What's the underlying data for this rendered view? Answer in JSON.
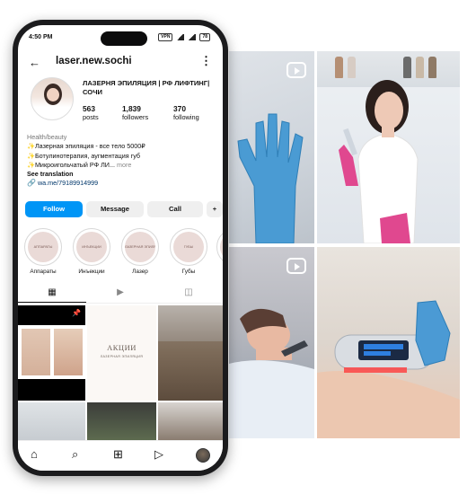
{
  "status_bar": {
    "time": "4:50 PM",
    "badge_vpn": "VPN",
    "battery": "78"
  },
  "profile": {
    "username": "laser.new.sochi",
    "display_name": "ЛАЗЕРНЯ ЭПИЛЯЦИЯ | РФ ЛИФТИНГ| СОЧИ",
    "stats": [
      {
        "value": "563",
        "label": "posts"
      },
      {
        "value": "1,839",
        "label": "followers"
      },
      {
        "value": "370",
        "label": "following"
      }
    ],
    "category": "Health/beauty",
    "bio_lines": [
      "✨Лазерная эпиляция - все тело 5000₽",
      "✨Ботулинотерапия, аугментация губ",
      "✨Микроигольчатый РФ ЛИ..."
    ],
    "more_label": "more",
    "see_translation": "See translation",
    "link": "wa.me/79189914999"
  },
  "actions": {
    "follow": "Follow",
    "message": "Message",
    "call": "Call",
    "add_person": "+"
  },
  "highlights": [
    {
      "label": "Аппараты",
      "cover": "АППАРАТЫ"
    },
    {
      "label": "Инъекции",
      "cover": "ИНЪЕКЦИИ"
    },
    {
      "label": "Лазер",
      "cover": "ЛАЗЕРНАЯ ЭПИЛЯЦИЯ"
    },
    {
      "label": "Губы",
      "cover": "ГУБЫ"
    },
    {
      "label": "",
      "cover": ""
    }
  ],
  "grid": {
    "promo_title": "АКЦИИ",
    "promo_subtitle": "ЛАЗЕРНАЯ ЭПИЛЯЦИЯ"
  },
  "icons": {
    "back": "arrow-left",
    "menu": "more-vertical",
    "tab_grid": "grid",
    "tab_reels": "reels",
    "tab_tagged": "tagged",
    "nav": [
      "home",
      "search",
      "create",
      "reels",
      "profile"
    ]
  },
  "colors": {
    "follow_button": "#0095f6",
    "link": "#00376b"
  }
}
